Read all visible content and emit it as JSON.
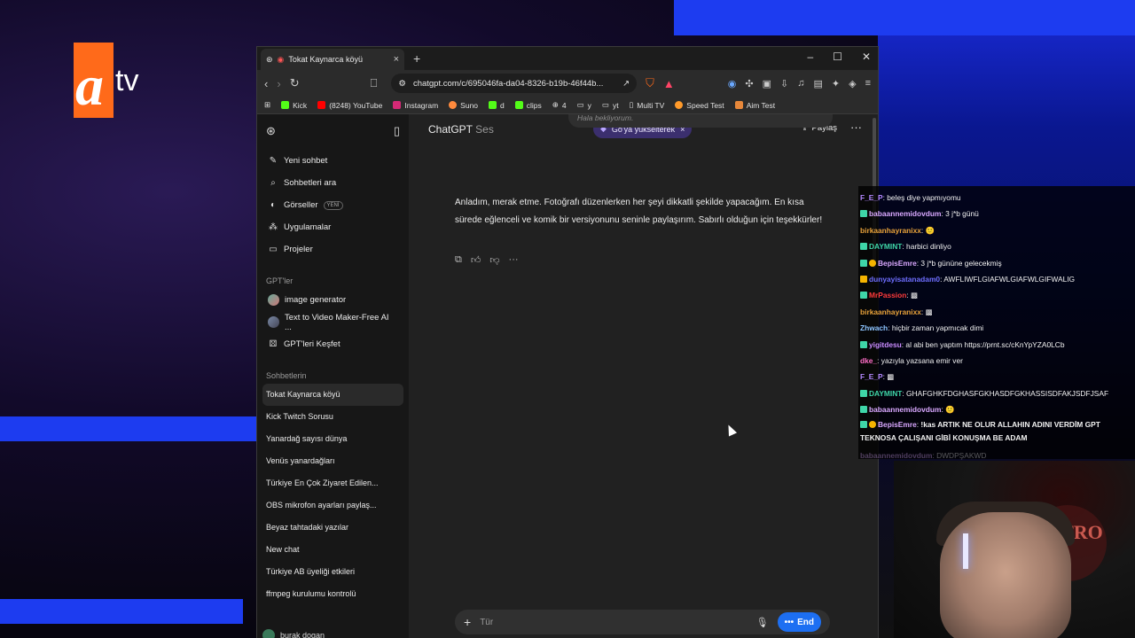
{
  "overlay": {
    "logo_a": "a",
    "logo_tv": "tv"
  },
  "browser": {
    "tab_title": "Tokat Kaynarca köyü",
    "url": "chatgpt.com/c/695046fa-da04-8326-b19b-46f44b...",
    "bookmarks": [
      "Kick",
      "(8248) YouTube",
      "Instagram",
      "Suno",
      "d",
      "clips",
      "4",
      "y",
      "yt",
      "Multi TV",
      "Speed Test",
      "Aim Test"
    ]
  },
  "sidebar": {
    "nav": [
      {
        "icon": "edit-icon",
        "label": "Yeni sohbet"
      },
      {
        "icon": "search-icon",
        "label": "Sohbetleri ara"
      },
      {
        "icon": "image-icon",
        "label": "Görseller",
        "badge": "YENİ"
      },
      {
        "icon": "apps-icon",
        "label": "Uygulamalar"
      },
      {
        "icon": "folder-icon",
        "label": "Projeler"
      }
    ],
    "gpts_heading": "GPT'ler",
    "gpts": [
      "image generator",
      "Text to Video Maker-Free AI ...",
      "GPT'leri Keşfet"
    ],
    "chats_heading": "Sohbetlerin",
    "chats": [
      "Tokat Kaynarca köyü",
      "Kick Twitch Sorusu",
      "Yanardağ sayısı dünya",
      "Venüs yanardağları",
      "Türkiye En Çok Ziyaret Edilen...",
      "OBS mikrofon ayarları paylaş...",
      "Beyaz tahtadaki yazılar",
      "New chat",
      "Türkiye AB üyeliği etkileri",
      "ffmpeg kurulumu kontrolü"
    ],
    "user_name": "burak dogan"
  },
  "main": {
    "model": "ChatGPT",
    "model_sub": "Ses",
    "upgrade": "Go'ya yükselterek",
    "share": "Paylaş",
    "prev_message": "Hala bekliyorum.",
    "answer": "Anladım, merak etme. Fotoğrafı düzenlerken her şeyi dikkatli şekilde yapacağım. En kısa sürede eğlenceli ve komik bir versiyonunu seninle paylaşırım. Sabırlı olduğun için teşekkürler!",
    "composer_placeholder": "Tür",
    "end_label": "End"
  },
  "chat": [
    {
      "user": "F_E_P",
      "color": "#b388ff",
      "text": "beleş diye yapmıyomu"
    },
    {
      "user": "babaannemidovdum",
      "color": "#d9a8ff",
      "text": "3 j*b günü"
    },
    {
      "user": "birkaanhayranixx",
      "color": "#e8a23a",
      "text": ""
    },
    {
      "user": "DAYMINT",
      "color": "#3fd6a8",
      "text": "harbici dinliyo"
    },
    {
      "user": "BepisEmre",
      "color": "#d9a8ff",
      "text": "3 j*b gününe gelecekmiş"
    },
    {
      "user": "dunyayisatanadam0",
      "color": "#6e6eff",
      "text": "AWFLIWFLGIAFWLGIAFWLGIFWALIG"
    },
    {
      "user": "MrPassion",
      "color": "#ff3b3b",
      "text": ""
    },
    {
      "user": "birkaanhayranixx",
      "color": "#e8a23a",
      "text": ""
    },
    {
      "user": "Zhwach",
      "color": "#8ec5ff",
      "text": "hiçbir zaman yapmıcak dimi"
    },
    {
      "user": "yigitdesu",
      "color": "#c98bff",
      "text": "al abi ben yaptım https://prnt.sc/cKnYpYZA0LCb"
    },
    {
      "user": "dke_",
      "color": "#ff6ec7",
      "text": "yazıyla yazsana emir ver"
    },
    {
      "user": "F_E_P",
      "color": "#b388ff",
      "text": ""
    },
    {
      "user": "DAYMINT",
      "color": "#3fd6a8",
      "text": "GHAFGHKFDGHASFGKHASDFGKHASSISDFAKJSDFJSAF"
    },
    {
      "user": "babaannemidovdum",
      "color": "#d9a8ff",
      "text": ""
    },
    {
      "user": "BepisEmre",
      "color": "#d9a8ff",
      "text": "!kas ARTIK NE OLUR ALLAHIN ADINI VERDİM GPT TEKNOSA ÇALIŞANI GİBİ KONUŞMA BE ADAM"
    },
    {
      "user": "babaannemidovdum",
      "color": "#d9a8ff",
      "text": "DWDPŞAKWD"
    }
  ],
  "webcam": {
    "poster_text": "ASTRO"
  },
  "colors": {
    "accent_blue": "#1d6ff2",
    "upgrade_purple": "#3b2f6e",
    "atv_orange": "#ff6a1a"
  }
}
